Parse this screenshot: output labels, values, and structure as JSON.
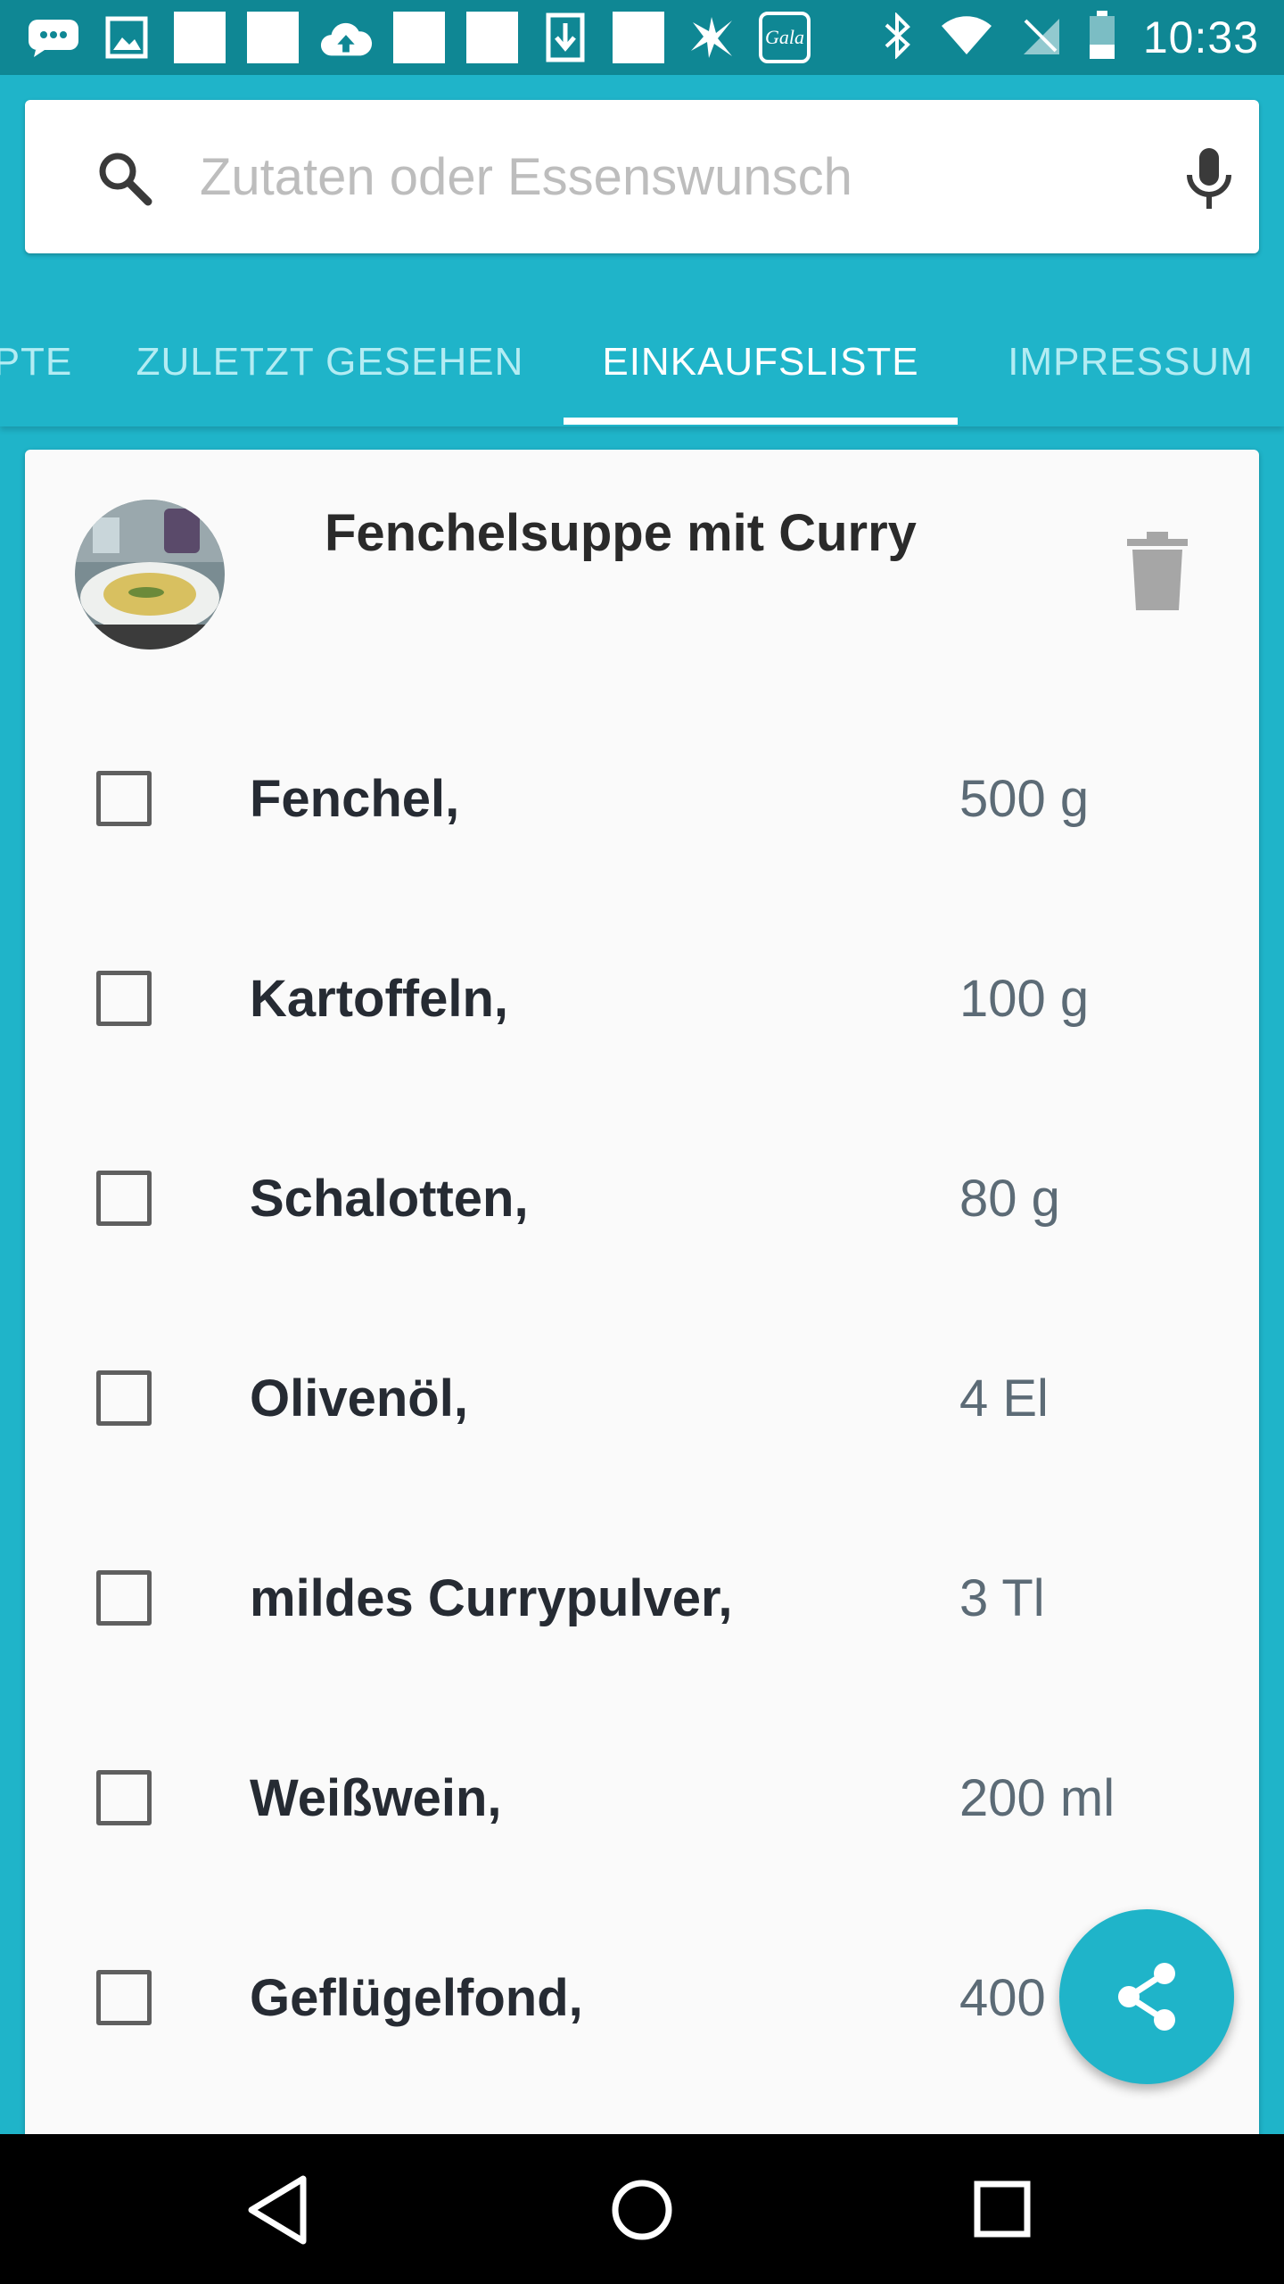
{
  "status_bar": {
    "time": "10:33",
    "left_icons": [
      "chat-notification-icon",
      "image-notification-icon",
      "white-square-notification-icon",
      "white-square-notification-icon",
      "cloud-upload-icon",
      "white-square-notification-icon",
      "white-square-notification-icon",
      "download-icon",
      "white-square-notification-icon",
      "starburst-icon",
      "gala-app-icon"
    ],
    "gala_label": "Gala",
    "right_icons": [
      "bluetooth-icon",
      "wifi-icon",
      "no-sim-icon",
      "battery-icon"
    ]
  },
  "search": {
    "placeholder": "Zutaten oder Essenswunsch",
    "value": ""
  },
  "tabs": [
    {
      "label": "PTE",
      "active": false
    },
    {
      "label": "ZULETZT GESEHEN",
      "active": false
    },
    {
      "label": "EINKAUFSLISTE",
      "active": true
    },
    {
      "label": "IMPRESSUM",
      "active": false
    }
  ],
  "recipe": {
    "title": "Fenchelsuppe mit Curry",
    "ingredients": [
      {
        "name": "Fenchel,",
        "amount": "500 g",
        "checked": false
      },
      {
        "name": "Kartoffeln,",
        "amount": "100 g",
        "checked": false
      },
      {
        "name": "Schalotten,",
        "amount": "80 g",
        "checked": false
      },
      {
        "name": "Olivenöl,",
        "amount": "4 El",
        "checked": false
      },
      {
        "name": "mildes Currypulver,",
        "amount": "3 Tl",
        "checked": false
      },
      {
        "name": "Weißwein,",
        "amount": "200 ml",
        "checked": false
      },
      {
        "name": "Geflügelfond,",
        "amount": "400",
        "checked": false
      }
    ]
  },
  "colors": {
    "primary": "#1fb4c9",
    "status_bar": "#0f8794",
    "tab_inactive": "#b3ecf3"
  }
}
